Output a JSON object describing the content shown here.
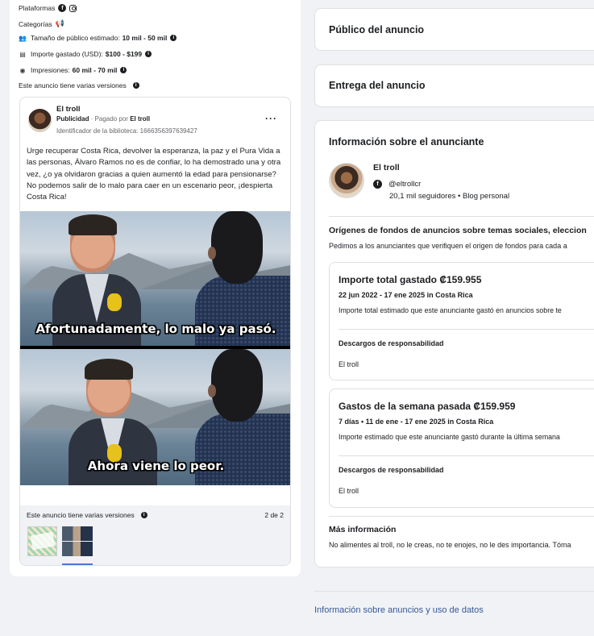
{
  "left": {
    "platforms_label": "Plataformas",
    "categories_label": "Categorías",
    "audience_label": "Tamaño de público estimado:",
    "audience_value": "10 mil - 50 mil",
    "spend_label": "Importe gastado (USD):",
    "spend_value": "$100 - $199",
    "impressions_label": "Impresiones:",
    "impressions_value": "60 mil - 70 mil",
    "multi_versions": "Este anuncio tiene varias versiones"
  },
  "ad": {
    "page_name": "El troll",
    "sponsored": "Publicidad",
    "paid_by_prefix": "· Pagado por",
    "paid_by": "El troll",
    "library_id": "Identificador de la biblioteca: 1666356397639427",
    "more": "···",
    "body": "Urge recuperar Costa Rica, devolver la esperanza, la paz y el Pura Vida a las personas, Álvaro Ramos no es de confiar, lo ha demostrado una y otra vez, ¿o ya olvidaron gracias a quien aumentó la edad para pensionarse? No podemos salir de lo malo para caer en un escenario peor, ¡despierta Costa Rica!",
    "caption_1": "Afortunadamente, lo malo ya pasó.",
    "caption_2": "Ahora viene lo peor.",
    "versions_label": "Este anuncio tiene varias versiones",
    "versions_count": "2 de 2"
  },
  "right": {
    "audience_title": "Público del anuncio",
    "delivery_title": "Entrega del anuncio",
    "advertiser_title": "Información sobre el anunciante",
    "advertiser_name": "El troll",
    "advertiser_handle": "@eltrollcr",
    "advertiser_followers": "20,1 mil seguidores • Blog personal",
    "funds_title": "Orígenes de fondos de anuncios sobre temas sociales, eleccion",
    "funds_desc": "Pedimos a los anunciantes que verifiquen el origen de fondos para cada a",
    "total": {
      "title": "Importe total gastado ₡159.955",
      "dates": "22 jun 2022 - 17 ene 2025 in Costa Rica",
      "desc": "Importe total estimado que este anunciante gastó en anuncios sobre te",
      "disclaimer_label": "Descargos de responsabilidad",
      "disclaimer_value": "El troll"
    },
    "week": {
      "title": "Gastos de la semana pasada ₡159.959",
      "dates": "7 días • 11 de ene - 17 ene 2025 in Costa Rica",
      "desc": "Importe estimado que este anunciante gastó durante la última semana",
      "disclaimer_label": "Descargos de responsabilidad",
      "disclaimer_value": "El troll"
    },
    "more_title": "Más información",
    "more_text": "No alimentes al troll, no le creas, no te enojes, no le des importancia. Tóma"
  },
  "footer_link": "Información sobre anuncios y uso de datos"
}
